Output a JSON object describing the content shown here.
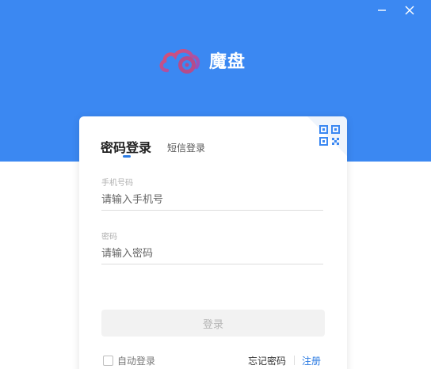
{
  "window": {
    "minimize_icon": "minimize-icon",
    "close_icon": "close-icon"
  },
  "brand": {
    "name": "魔盘",
    "logo_icon": "cloud-disc-icon",
    "accent": "#3b88f2"
  },
  "login": {
    "qr_icon": "qr-code-icon",
    "tabs": [
      {
        "label": "密码登录",
        "active": true
      },
      {
        "label": "短信登录",
        "active": false
      }
    ],
    "phone": {
      "label": "手机号码",
      "placeholder": "请输入手机号",
      "value": ""
    },
    "password": {
      "label": "密码",
      "placeholder": "请输入密码",
      "value": ""
    },
    "submit_label": "登录",
    "auto_login_label": "自动登录",
    "auto_login_checked": false,
    "forgot_label": "忘记密码",
    "register_label": "注册",
    "link_color": "#2a7ae2"
  }
}
